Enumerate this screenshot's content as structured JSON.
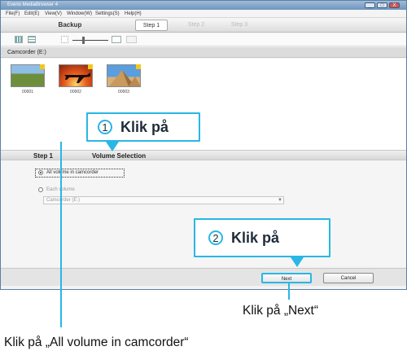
{
  "window": {
    "title": "Everio MediaBrowser 4",
    "buttons": [
      "_",
      "□",
      "X"
    ],
    "menu": [
      "File(F)",
      "Edit(E)",
      "View(V)",
      "Window(W)",
      "Settings(S)",
      "Help(H)"
    ]
  },
  "nav": {
    "backup": "Backup",
    "step1": "Step 1",
    "step2": "Step 2",
    "step3": "Step 3"
  },
  "source": {
    "label": "Camcorder (E:)",
    "thumbnails": [
      {
        "caption": "00001"
      },
      {
        "caption": "00002"
      },
      {
        "caption": "00003"
      }
    ]
  },
  "step": {
    "label": "Step 1",
    "title": "Volume Selection"
  },
  "options": {
    "all_volume": "All volume in camcorder",
    "each_volume": "Each volume",
    "device_value": "Camcorder (E:)"
  },
  "footer": {
    "next": "Next",
    "cancel": "Cancel"
  },
  "callouts": [
    {
      "number": "1",
      "text": "Klik på"
    },
    {
      "number": "2",
      "text": "Klik på"
    }
  ],
  "captions": {
    "next": "Klik på „Next“",
    "all_volume": "Klik på „All volume in camcorder“"
  },
  "colors": {
    "accent": "#29b7e5"
  }
}
